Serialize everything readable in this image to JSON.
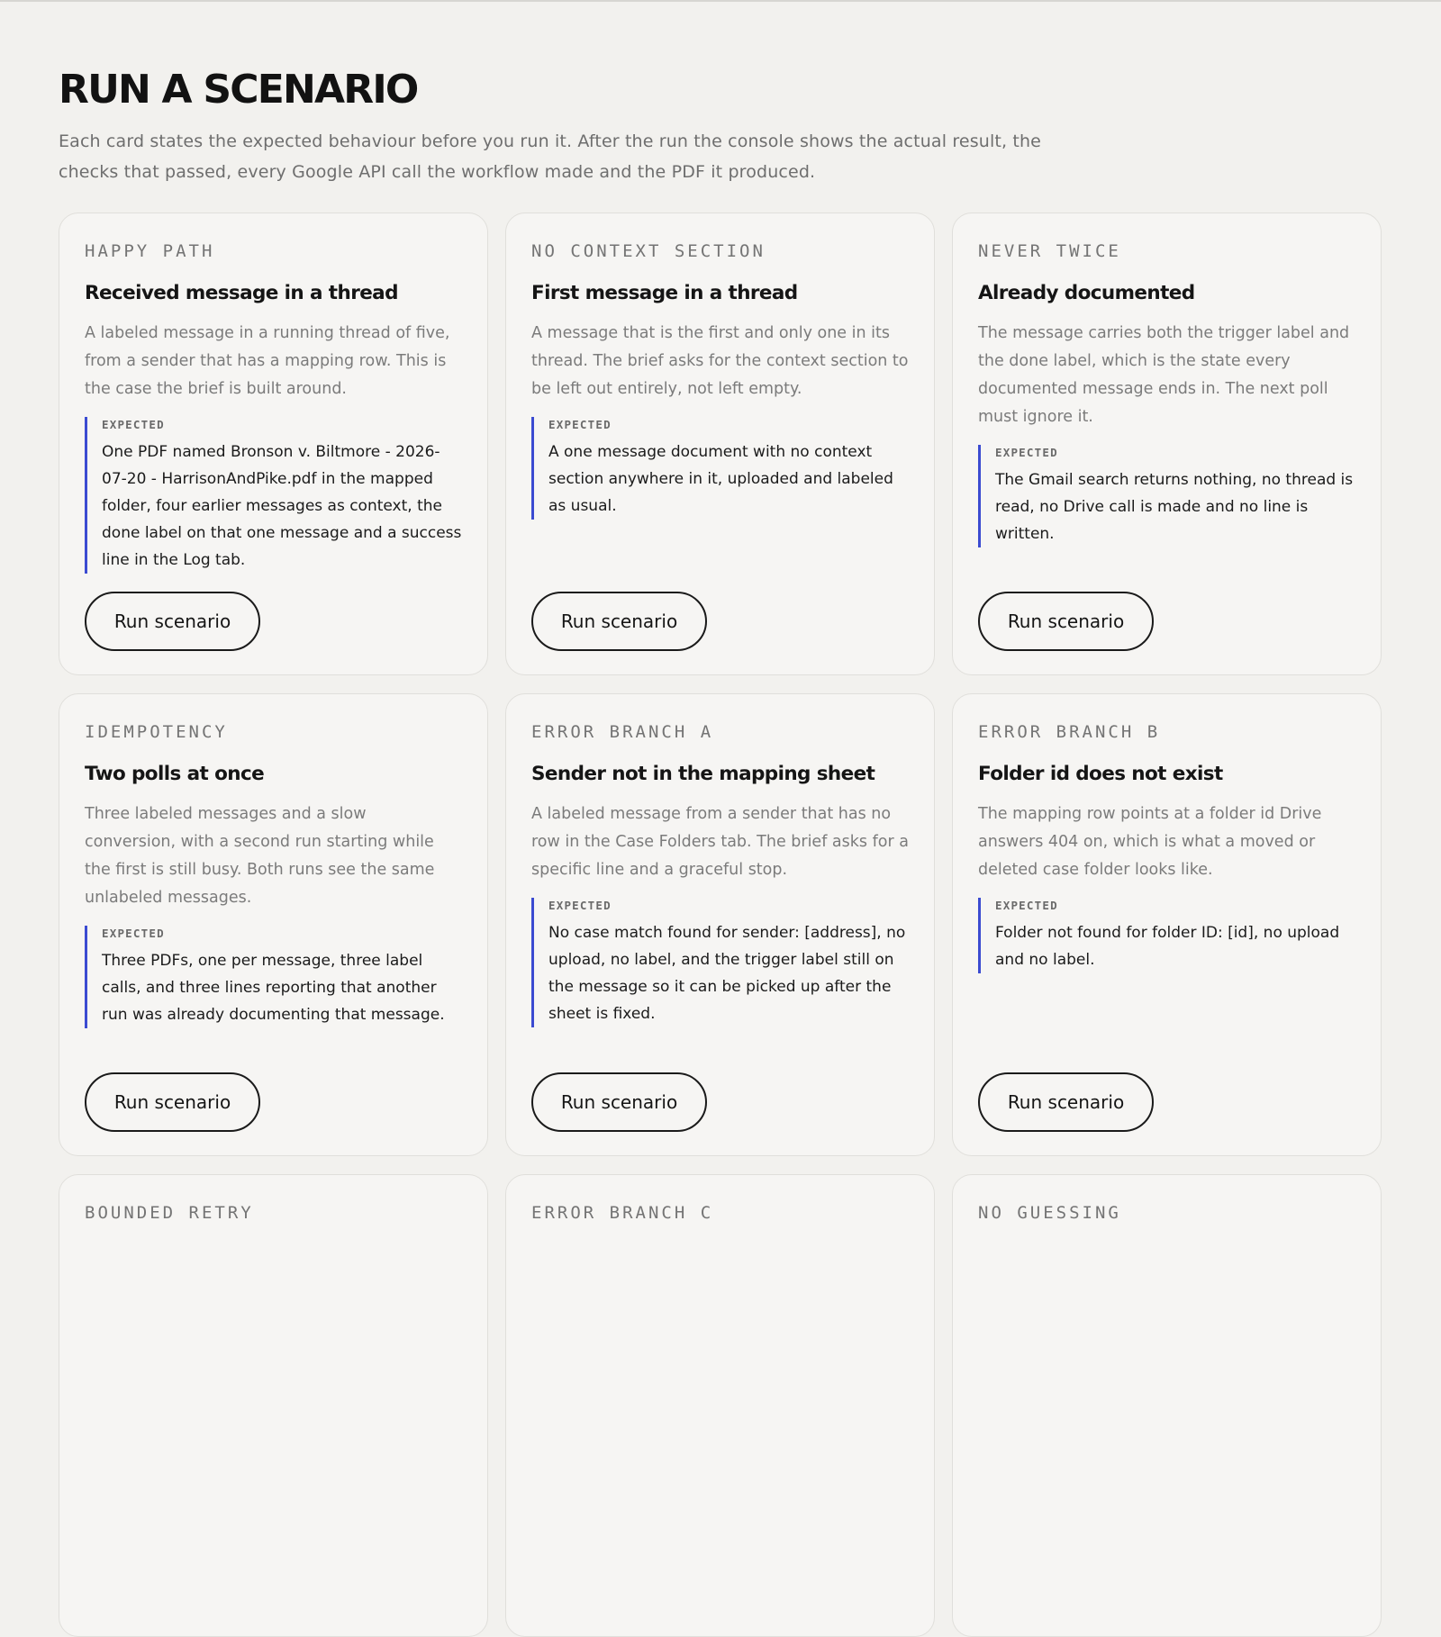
{
  "page": {
    "title": "RUN A SCENARIO",
    "intro": "Each card states the expected behaviour before you run it. After the run the console shows the actual result, the checks that passed, every Google API call the workflow made and the PDF it produced."
  },
  "cards": [
    {
      "tag": "HAPPY PATH",
      "title": "Received message in a thread",
      "description": "A labeled message in a running thread of five, from a sender that has a mapping row. This is the case the brief is built around.",
      "expected_label": "EXPECTED",
      "expected": "One PDF named Bronson v. Biltmore - 2026-07-20 - HarrisonAndPike.pdf in the mapped folder, four earlier messages as context, the done label on that one message and a success line in the Log tab.",
      "button": "Run scenario"
    },
    {
      "tag": "NO CONTEXT SECTION",
      "title": "First message in a thread",
      "description": "A message that is the first and only one in its thread. The brief asks for the context section to be left out entirely, not left empty.",
      "expected_label": "EXPECTED",
      "expected": "A one message document with no context section anywhere in it, uploaded and labeled as usual.",
      "button": "Run scenario"
    },
    {
      "tag": "NEVER TWICE",
      "title": "Already documented",
      "description": "The message carries both the trigger label and the done label, which is the state every documented message ends in. The next poll must ignore it.",
      "expected_label": "EXPECTED",
      "expected": "The Gmail search returns nothing, no thread is read, no Drive call is made and no line is written.",
      "button": "Run scenario"
    },
    {
      "tag": "IDEMPOTENCY",
      "title": "Two polls at once",
      "description": "Three labeled messages and a slow conversion, with a second run starting while the first is still busy. Both runs see the same unlabeled messages.",
      "expected_label": "EXPECTED",
      "expected": "Three PDFs, one per message, three label calls, and three lines reporting that another run was already documenting that message.",
      "button": "Run scenario"
    },
    {
      "tag": "ERROR BRANCH A",
      "title": "Sender not in the mapping sheet",
      "description": "A labeled message from a sender that has no row in the Case Folders tab. The brief asks for a specific line and a graceful stop.",
      "expected_label": "EXPECTED",
      "expected": "No case match found for sender: [address], no upload, no label, and the trigger label still on the message so it can be picked up after the sheet is fixed.",
      "button": "Run scenario"
    },
    {
      "tag": "ERROR BRANCH B",
      "title": "Folder id does not exist",
      "description": "The mapping row points at a folder id Drive answers 404 on, which is what a moved or deleted case folder looks like.",
      "expected_label": "EXPECTED",
      "expected": "Folder not found for folder ID: [id], no upload and no label.",
      "button": "Run scenario"
    },
    {
      "tag": "BOUNDED RETRY",
      "title": "",
      "description": "",
      "expected_label": "",
      "expected": "",
      "button": ""
    },
    {
      "tag": "ERROR BRANCH C",
      "title": "",
      "description": "",
      "expected_label": "",
      "expected": "",
      "button": ""
    },
    {
      "tag": "NO GUESSING",
      "title": "",
      "description": "",
      "expected_label": "",
      "expected": "",
      "button": ""
    }
  ],
  "colors": {
    "background": "#f2f1ee",
    "card": "#f6f5f3",
    "accent_rule": "#3b4bd1"
  }
}
